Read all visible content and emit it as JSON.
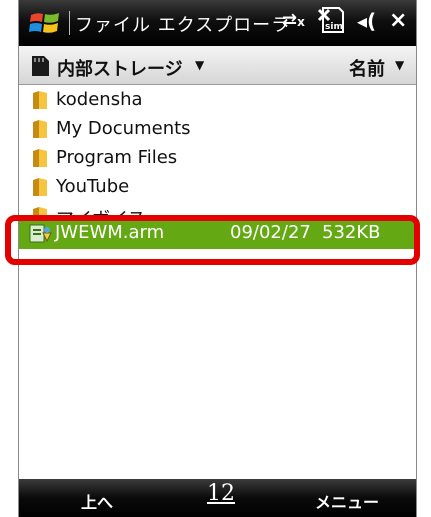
{
  "titlebar": {
    "title": "ファイル エクスプローラ",
    "close_label": "×"
  },
  "pathbar": {
    "location": "内部ストレージ",
    "sort": "名前"
  },
  "files": [
    {
      "name": "kodensha"
    },
    {
      "name": "My Documents"
    },
    {
      "name": "Program Files"
    },
    {
      "name": "YouTube"
    },
    {
      "name": "マイボイス"
    }
  ],
  "selected_file": {
    "name": "JWEWM.arm",
    "date": "09/02/27",
    "size": "532KB"
  },
  "softkeys": {
    "left": "上へ",
    "middle": "12",
    "right": "メニュー"
  },
  "colors": {
    "selection": "#64a813",
    "highlight": "#e30000"
  },
  "icons": [
    "windows-logo",
    "connectivity-icon",
    "no-sim-icon",
    "volume-icon",
    "close-icon",
    "storage-card-icon",
    "folder-icon",
    "cab-file-icon",
    "keyboard-icon"
  ]
}
